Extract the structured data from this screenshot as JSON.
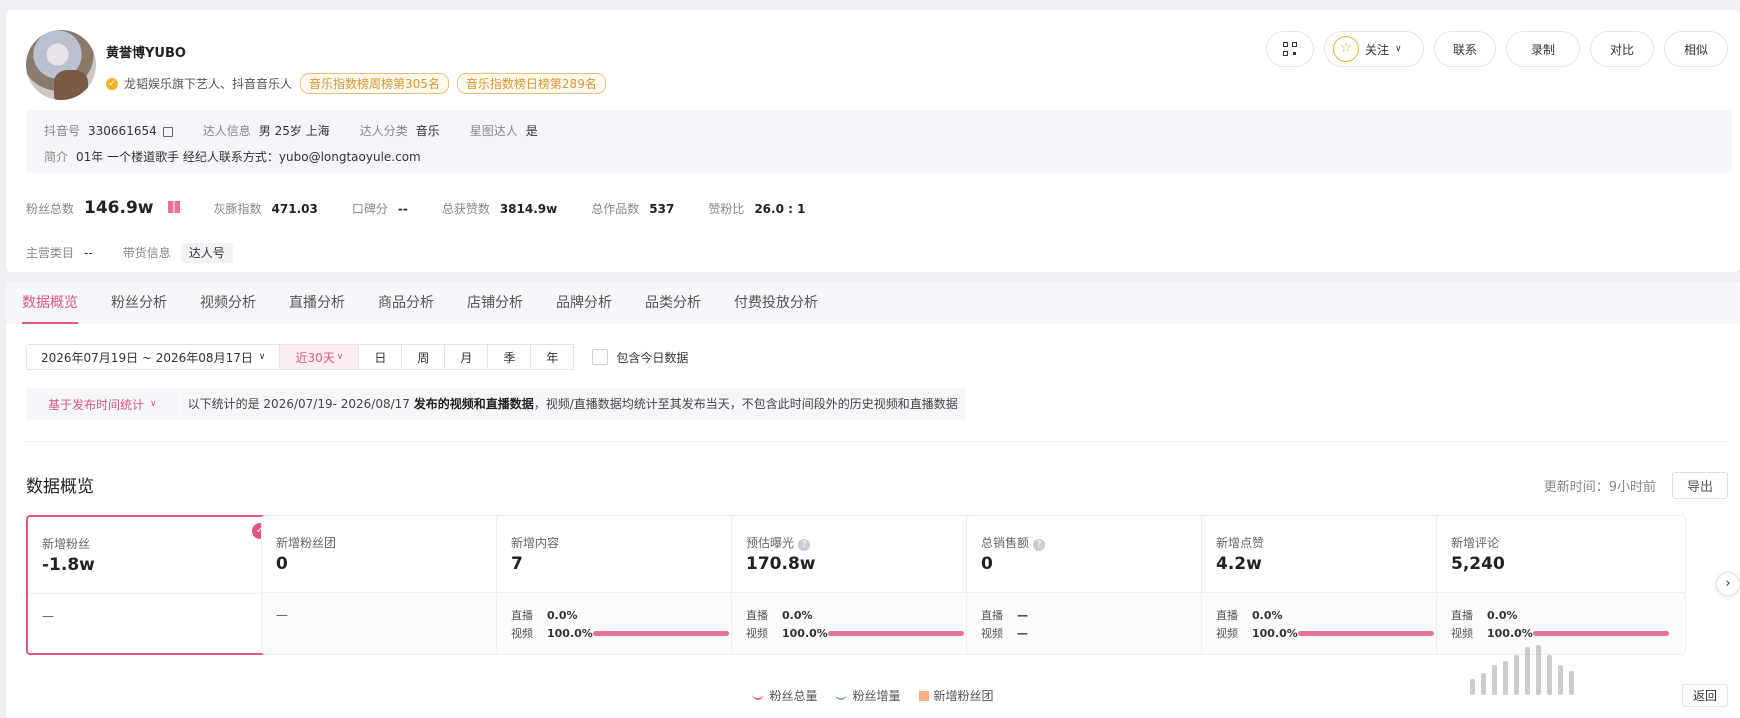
{
  "profile": {
    "name": "黄誉博YUBO",
    "verify_text": "龙韬娱乐旗下艺人、抖音音乐人",
    "rank_tags": [
      "音乐指数榜周榜第305名",
      "音乐指数榜日榜第289名"
    ],
    "actions": {
      "follow": "关注",
      "contact": "联系",
      "record": "录制",
      "compare": "对比",
      "similar": "相似"
    },
    "info": {
      "douyin_id_label": "抖音号",
      "douyin_id": "330661654",
      "talent_info_label": "达人信息",
      "talent_info": "男 25岁 上海",
      "category_label": "达人分类",
      "category": "音乐",
      "star_label": "星图达人",
      "star": "是",
      "bio_label": "简介",
      "bio": "01年 一个楼道歌手 经纪人联系方式：yubo@longtaoyule.com"
    },
    "stats": {
      "fans_label": "粉丝总数",
      "fans": "146.9w",
      "grey_label": "灰豚指数",
      "grey": "471.03",
      "reputation_label": "口碑分",
      "reputation": "--",
      "likes_label": "总获赞数",
      "likes": "3814.9w",
      "works_label": "总作品数",
      "works": "537",
      "ratio_label": "赞粉比",
      "ratio": "26.0 : 1",
      "main_category_label": "主营类目",
      "main_category": "--",
      "goods_label": "带货信息",
      "goods": "达人号"
    }
  },
  "tabs": [
    "数据概览",
    "粉丝分析",
    "视频分析",
    "直播分析",
    "商品分析",
    "店铺分析",
    "品牌分析",
    "品类分析",
    "付费投放分析"
  ],
  "filters": {
    "date_range": "2026年07月19日 ~ 2026年08月17日",
    "quick": "近30天",
    "periods": [
      "日",
      "周",
      "月",
      "季",
      "年"
    ],
    "include_today": "包含今日数据"
  },
  "notice": {
    "select": "基于发布时间统计",
    "text_pre": "以下统计的是 2026/07/19- 2026/08/17 ",
    "text_bold": "发布的视频和直播数据",
    "text_post": "，视频/直播数据均统计至其发布当天，不包含此时间段外的历史视频和直播数据"
  },
  "overview": {
    "title": "数据概览",
    "update_label": "更新时间：9小时前",
    "export": "导出",
    "cards": [
      {
        "title": "新增粉丝",
        "value": "-1.8w",
        "dash": "—"
      },
      {
        "title": "新增粉丝团",
        "value": "0",
        "dash": "—"
      },
      {
        "title": "新增内容",
        "value": "7",
        "live_label": "直播",
        "live_pct": "0.0%",
        "video_label": "视频",
        "video_pct": "100.0%"
      },
      {
        "title": "预估曝光",
        "value": "170.8w",
        "live_label": "直播",
        "live_pct": "0.0%",
        "video_label": "视频",
        "video_pct": "100.0%"
      },
      {
        "title": "总销售额",
        "value": "0",
        "live_label": "直播",
        "live_pct": "—",
        "video_label": "视频",
        "video_pct": "—"
      },
      {
        "title": "新增点赞",
        "value": "4.2w",
        "live_label": "直播",
        "live_pct": "0.0%",
        "video_label": "视频",
        "video_pct": "100.0%"
      },
      {
        "title": "新增评论",
        "value": "5,240",
        "live_label": "直播",
        "live_pct": "0.0%",
        "video_label": "视频",
        "video_pct": "100.0%"
      }
    ]
  },
  "legend": [
    "粉丝总量",
    "粉丝增量",
    "新增粉丝团"
  ],
  "back_label": "返回",
  "colors": {
    "accent": "#e05585",
    "gold": "#d9962b",
    "bar": "#e8729a"
  }
}
